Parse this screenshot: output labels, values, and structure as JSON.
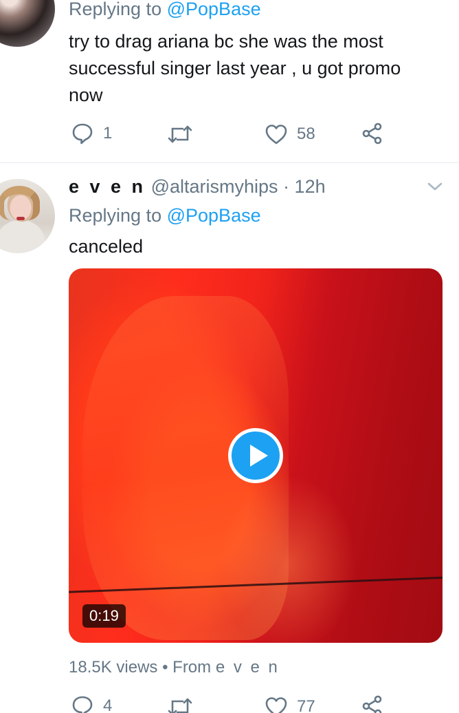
{
  "tweet_1": {
    "replying_label": "Replying to",
    "replying_handle": "@PopBase",
    "text_lines": [
      "try to drag ariana bc she was the most",
      "successful singer last year , u got promo",
      "now"
    ],
    "actions": {
      "replies": "1",
      "retweets": "",
      "likes": "58"
    }
  },
  "tweet_2": {
    "name": "e v e n",
    "handle": "@altarismyhips",
    "separator": "·",
    "time": "12h",
    "replying_label": "Replying to",
    "replying_handle": "@PopBase",
    "text": "canceled",
    "video": {
      "duration": "0:19",
      "play_color": "#1da1f2"
    },
    "views": "18.5K views",
    "dot": "•",
    "from_label": "From",
    "from_name": "e v e n",
    "actions": {
      "replies": "4",
      "retweets": "",
      "likes": "77"
    }
  },
  "colors": {
    "accent": "#1da1f2",
    "muted": "#657786",
    "text": "#14171a"
  },
  "icons": [
    "reply-icon",
    "retweet-icon",
    "like-icon",
    "share-icon",
    "chevron-down-icon",
    "play-icon"
  ]
}
